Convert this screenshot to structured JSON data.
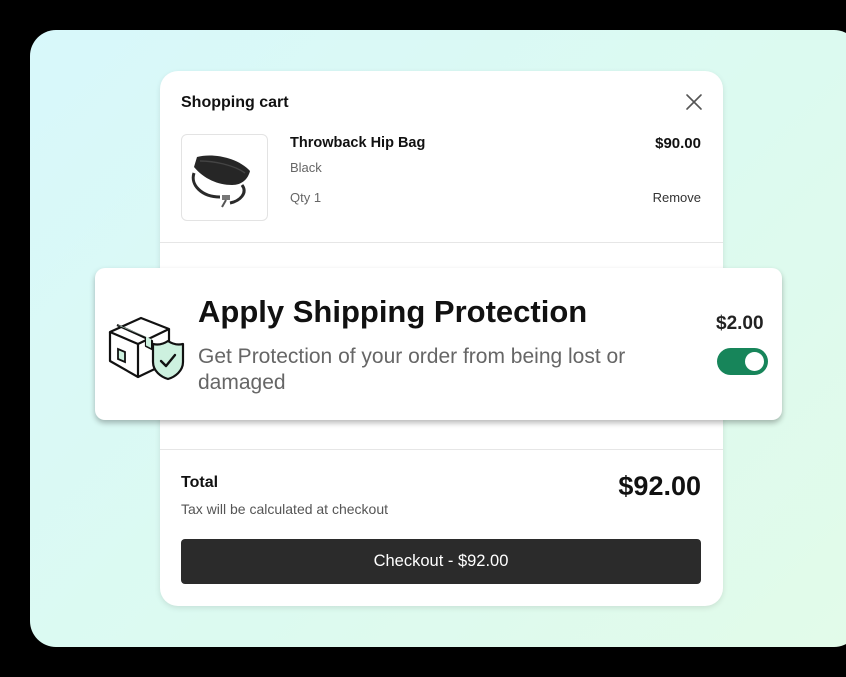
{
  "cart": {
    "title": "Shopping cart",
    "item": {
      "name": "Throwback Hip Bag",
      "variant": "Black",
      "quantity": "Qty 1",
      "price": "$90.00",
      "remove_label": "Remove",
      "image": "hip-bag-image"
    },
    "total_label": "Total",
    "tax_note": "Tax will be calculated at checkout",
    "total_amount": "$92.00",
    "checkout_label": "Checkout - $92.00"
  },
  "protection": {
    "title": "Apply Shipping Protection",
    "description": "Get Protection of your order from being lost or damaged",
    "price": "$2.00",
    "enabled": true,
    "icon": "package-shield-icon"
  },
  "colors": {
    "toggle_on": "#17855a",
    "checkout_button": "#2b2b2b",
    "background_gradient": [
      "#d8f8fb",
      "#e2fbe9"
    ],
    "shield_fill": "#cdf1df"
  }
}
